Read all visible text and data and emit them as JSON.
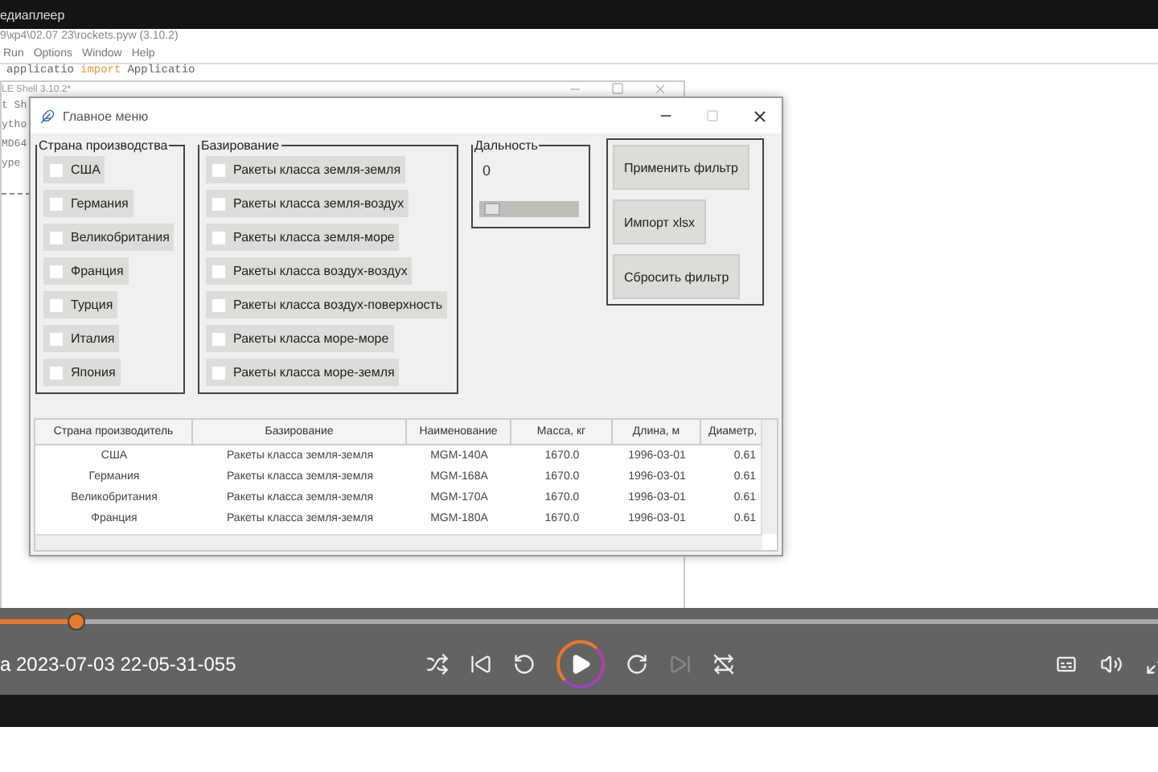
{
  "player": {
    "title": "едиаплеер",
    "file_name": "а 2023-07-03 22-05-31-055",
    "seek": {
      "level": 0.065
    },
    "controls": [
      {
        "kind": "shuffle",
        "disabled": false
      },
      {
        "kind": "previous",
        "disabled": false
      },
      {
        "kind": "rewind",
        "disabled": false
      },
      {
        "kind": "play",
        "disabled": false
      },
      {
        "kind": "forward",
        "disabled": false
      },
      {
        "kind": "next",
        "disabled": true
      },
      {
        "kind": "repeat-off",
        "disabled": false
      }
    ],
    "right_controls": [
      {
        "kind": "subtitles"
      },
      {
        "kind": "volume"
      },
      {
        "kind": "fullscreen"
      }
    ]
  },
  "editor": {
    "title": "9\\кр4\\02.07 23\\rockets.pyw (3.10.2)",
    "menu": [
      "Run",
      "Options",
      "Window",
      "Help"
    ],
    "code": [
      {
        "text": "applicatio",
        "kind": "name"
      },
      {
        "text": "import",
        "kind": "keyword"
      },
      {
        "text": "Applicatio",
        "kind": "name"
      }
    ]
  },
  "shell": {
    "title": "LE Shell 3.10.2*",
    "menu": "t Sh",
    "lines": [
      "ytho",
      "MD64",
      "ype"
    ]
  },
  "main_window": {
    "title": "Главное меню",
    "country": {
      "label": "Страна производства",
      "options": [
        {
          "label": "США",
          "checked": false
        },
        {
          "label": "Германия",
          "checked": false
        },
        {
          "label": "Великобритания",
          "checked": false
        },
        {
          "label": "Франция",
          "checked": false
        },
        {
          "label": "Турция",
          "checked": false
        },
        {
          "label": "Италия",
          "checked": false
        },
        {
          "label": "Япония",
          "checked": false
        }
      ]
    },
    "basing": {
      "label": "Базирование",
      "options": [
        {
          "label": "Ракеты класса земля-земля",
          "checked": false
        },
        {
          "label": "Ракеты класса земля-воздух",
          "checked": false
        },
        {
          "label": "Ракеты класса земля-море",
          "checked": false
        },
        {
          "label": "Ракеты класса воздух-воздух",
          "checked": false
        },
        {
          "label": "Ракеты класса воздух-поверхность",
          "checked": false
        },
        {
          "label": "Ракеты класса море-море",
          "checked": false
        },
        {
          "label": "Ракеты класса море-земля",
          "checked": false
        }
      ]
    },
    "range": {
      "label": "Дальность",
      "value": "0",
      "level": 0.05
    },
    "buttons": [
      "Применить фильтр",
      "Импорт xlsx",
      "Сбросить фильтр"
    ],
    "table": {
      "columns": [
        "Страна производитель",
        "Базирование",
        "Наименование",
        "Масса, кг",
        "Длина, м",
        "Диаметр,"
      ],
      "rows": [
        [
          "США",
          "Ракеты класса земля-земля",
          "MGM-140A",
          "1670.0",
          "1996-03-01",
          "0.61"
        ],
        [
          "Германия",
          "Ракеты класса земля-земля",
          "MGM-168A",
          "1670.0",
          "1996-03-01",
          "0.61"
        ],
        [
          "Великобритания",
          "Ракеты класса земля-земля",
          "MGM-170A",
          "1670.0",
          "1996-03-01",
          "0.61"
        ],
        [
          "Франция",
          "Ракеты класса земля-земля",
          "MGM-180A",
          "1670.0",
          "1996-03-01",
          "0.61"
        ]
      ]
    }
  }
}
